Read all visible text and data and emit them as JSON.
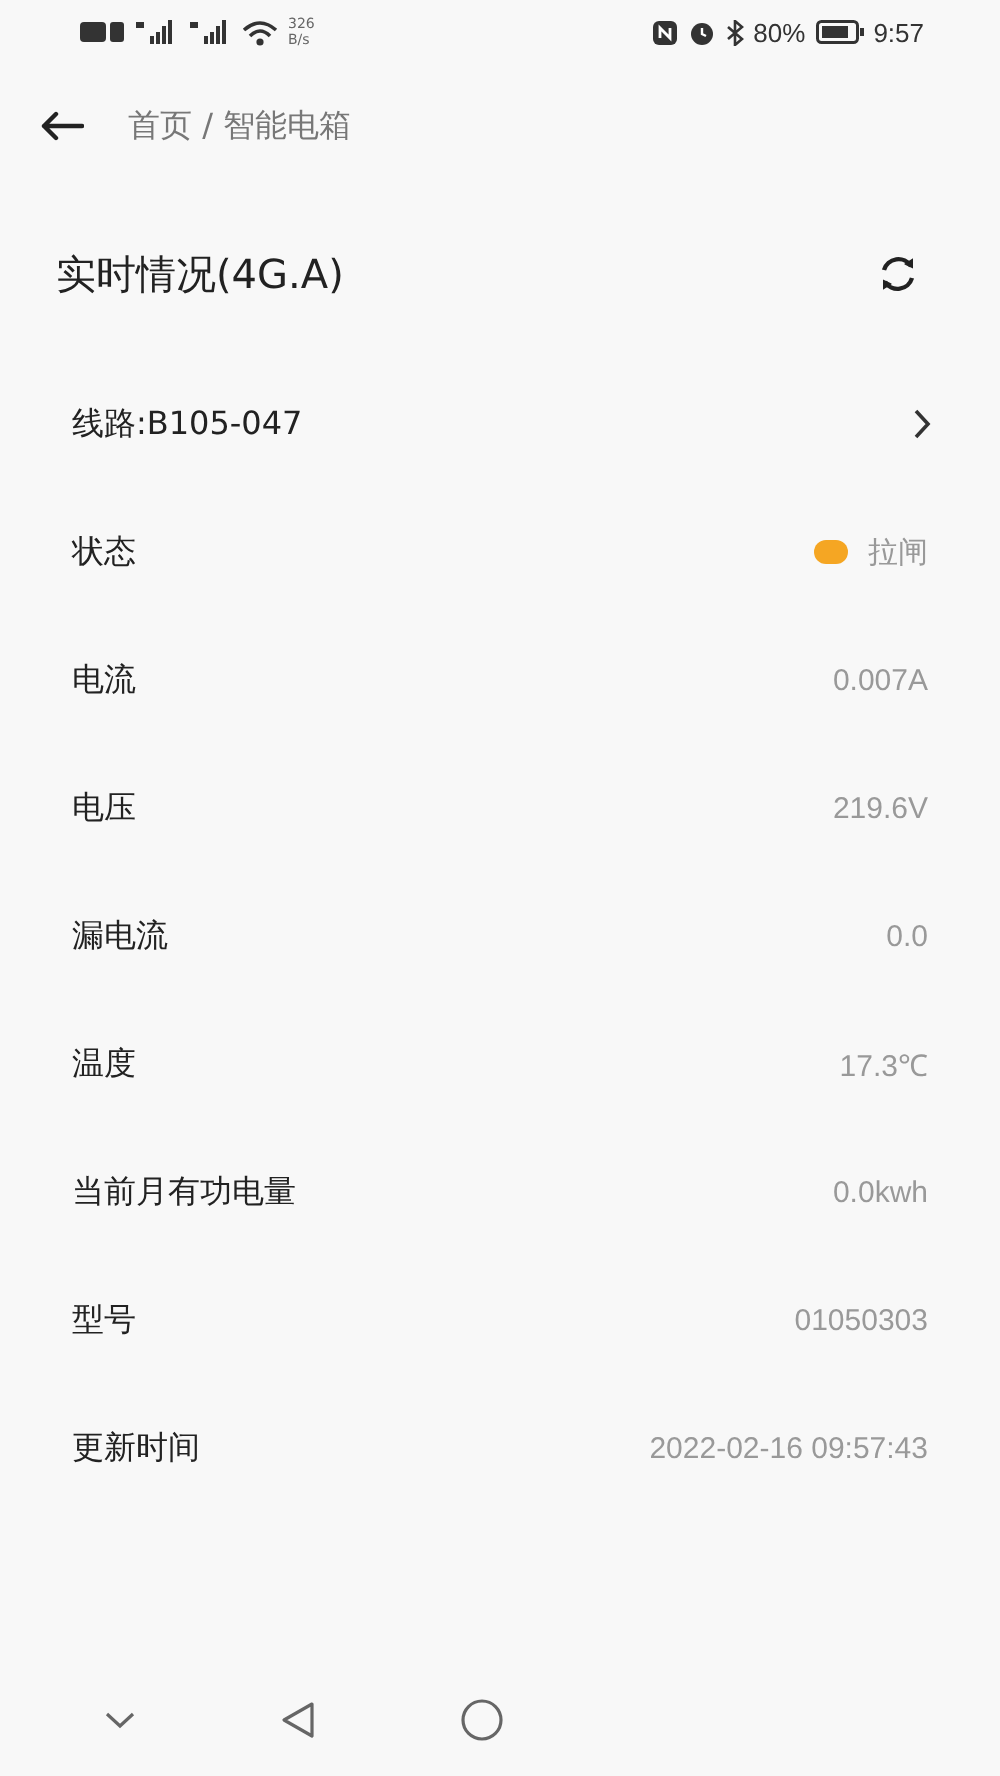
{
  "status_bar": {
    "network_speed": "326",
    "speed_unit": "B/s",
    "battery": "80%",
    "time": "9:57"
  },
  "breadcrumb": "首页 / 智能电箱",
  "title": "实时情况(4G.A)",
  "rows": [
    {
      "kind": "link",
      "label": "线路:B105-047"
    },
    {
      "kind": "status",
      "label": "状态",
      "value": "拉闸",
      "color": "#f5a623"
    },
    {
      "kind": "value",
      "label": "电流",
      "value": "0.007A"
    },
    {
      "kind": "value",
      "label": "电压",
      "value": "219.6V"
    },
    {
      "kind": "value",
      "label": "漏电流",
      "value": "0.0"
    },
    {
      "kind": "value",
      "label": "温度",
      "value": "17.3℃"
    },
    {
      "kind": "value",
      "label": "当前月有功电量",
      "value": "0.0kwh"
    },
    {
      "kind": "value",
      "label": "型号",
      "value": "01050303"
    },
    {
      "kind": "value",
      "label": "更新时间",
      "value": "2022-02-16 09:57:43"
    }
  ]
}
